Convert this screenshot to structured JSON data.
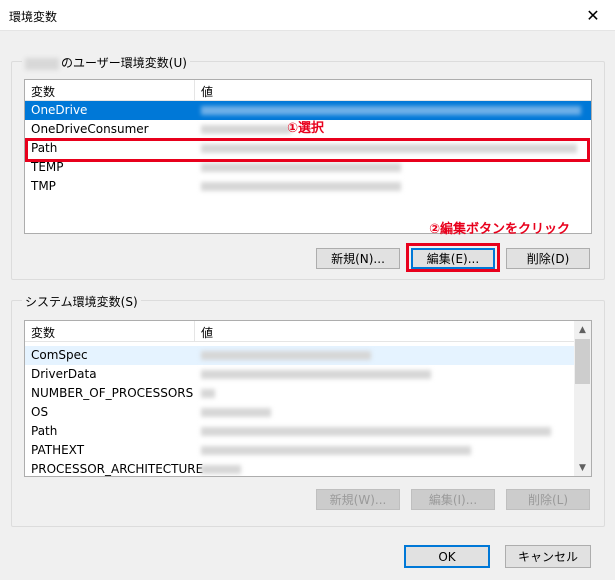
{
  "window": {
    "title": "環境変数",
    "close_glyph": "✕"
  },
  "user_group": {
    "label": "のユーザー環境変数(U)",
    "columns": [
      "変数",
      "値"
    ],
    "rows": [
      {
        "name": "OneDrive"
      },
      {
        "name": "OneDriveConsumer"
      },
      {
        "name": "Path"
      },
      {
        "name": "TEMP"
      },
      {
        "name": "TMP"
      }
    ],
    "buttons": {
      "new": "新規(N)...",
      "edit": "編集(E)...",
      "delete": "削除(D)"
    }
  },
  "system_group": {
    "label": "システム環境変数(S)",
    "columns": [
      "変数",
      "値"
    ],
    "rows": [
      {
        "name": "ComSpec"
      },
      {
        "name": "DriverData"
      },
      {
        "name": "NUMBER_OF_PROCESSORS"
      },
      {
        "name": "OS"
      },
      {
        "name": "Path"
      },
      {
        "name": "PATHEXT"
      },
      {
        "name": "PROCESSOR_ARCHITECTURE"
      }
    ],
    "buttons": {
      "new": "新規(W)...",
      "edit": "編集(I)...",
      "delete": "削除(L)"
    }
  },
  "annotations": {
    "step1": "①選択",
    "step2": "②編集ボタンをクリック"
  },
  "footer": {
    "ok": "OK",
    "cancel": "キャンセル"
  },
  "colors": {
    "selection": "#0078d7",
    "annotation_red": "#e8001c"
  }
}
